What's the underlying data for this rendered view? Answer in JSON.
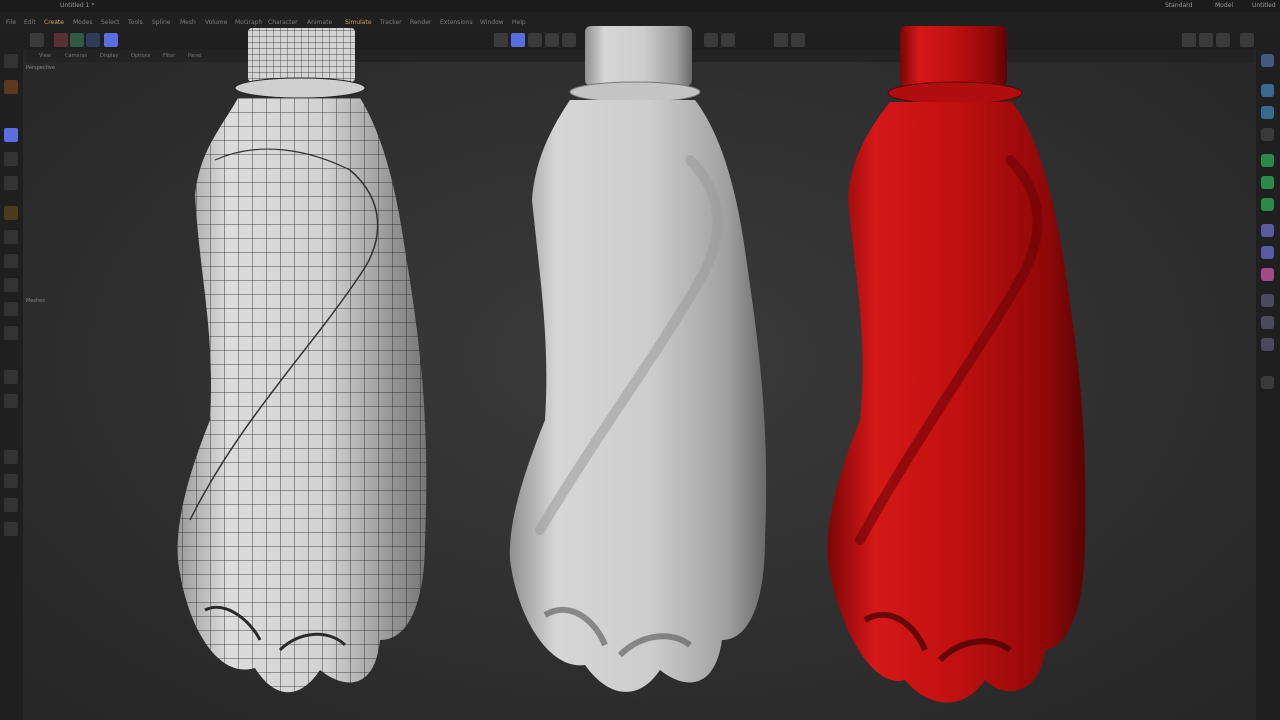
{
  "titlebar": {
    "tabs": [
      "Untitled 1 *",
      "Standard",
      "Model",
      "Untitled"
    ]
  },
  "menubar": {
    "items": [
      "File",
      "Edit",
      "Create",
      "Modes",
      "Select",
      "Tools",
      "Spline",
      "Mesh",
      "Volume",
      "MoGraph",
      "Character",
      "Animate",
      "Simulate",
      "Tracker",
      "Render",
      "Extensions",
      "Window",
      "Help"
    ]
  },
  "viewport_menu": {
    "items": [
      "View",
      "Cameras",
      "Display",
      "Options",
      "Filter",
      "Panel"
    ],
    "label": "Perspective",
    "side_label": "Meshes"
  },
  "colors": {
    "accent": "#5a6ee0",
    "bottle_red": "#c21010",
    "bottle_white": "#c9c9c9",
    "wire": "#1a1a1a"
  },
  "icons": {
    "left": [
      "move-icon",
      "scale-icon",
      "rotate-icon",
      "brush-icon",
      "knife-icon",
      "polygon-icon",
      "edge-icon",
      "point-icon"
    ],
    "right": [
      "cube-icon",
      "sphere-icon",
      "text-icon",
      "generator-icon",
      "deformer-icon",
      "light-icon",
      "camera-icon",
      "tag-icon"
    ]
  }
}
